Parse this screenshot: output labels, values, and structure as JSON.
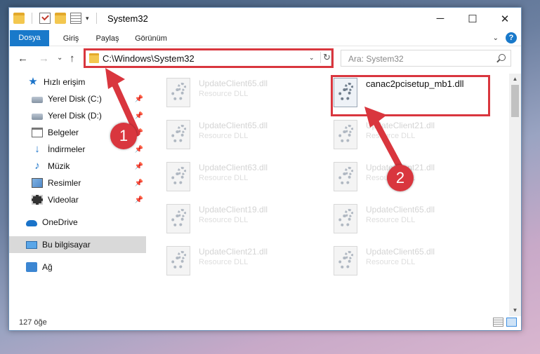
{
  "window": {
    "title": "System32",
    "minimize": "─",
    "maximize": "☐",
    "close": "✕"
  },
  "quick_access_toolbar": {
    "dropdown": "▾"
  },
  "ribbon": {
    "tabs": [
      "Dosya",
      "Giriş",
      "Paylaş",
      "Görünüm"
    ],
    "collapse": "⌄",
    "help": "?"
  },
  "nav": {
    "back": "←",
    "forward": "→",
    "recent": "⌄",
    "up": "↑"
  },
  "address": {
    "path": "C:\\Windows\\System32",
    "dropdown": "⌄",
    "refresh": "↻"
  },
  "search": {
    "placeholder": "Ara: System32"
  },
  "sidebar": {
    "items": [
      {
        "label": "Hızlı erişim",
        "icon": "star-icon",
        "pinned": false
      },
      {
        "label": "Yerel Disk (C:)",
        "icon": "drive-icon",
        "pinned": true
      },
      {
        "label": "Yerel Disk (D:)",
        "icon": "drive-icon",
        "pinned": true
      },
      {
        "label": "Belgeler",
        "icon": "documents-icon",
        "pinned": true
      },
      {
        "label": "İndirmeler",
        "icon": "download-icon",
        "pinned": true
      },
      {
        "label": "Müzik",
        "icon": "music-icon",
        "pinned": true
      },
      {
        "label": "Resimler",
        "icon": "pictures-icon",
        "pinned": true
      },
      {
        "label": "Videolar",
        "icon": "video-icon",
        "pinned": true
      },
      {
        "label": "OneDrive",
        "icon": "cloud-icon",
        "pinned": false
      },
      {
        "label": "Bu bilgisayar",
        "icon": "computer-icon",
        "pinned": false,
        "selected": true
      },
      {
        "label": "Ağ",
        "icon": "network-icon",
        "pinned": false
      }
    ],
    "pin_glyph": "📌"
  },
  "files": [
    {
      "name": "UpdateClient65.dll",
      "type": "Resource DLL",
      "active": false
    },
    {
      "name": "canac2pcisetup_mb1.dll",
      "type": "",
      "active": true
    },
    {
      "name": "UpdateClient65.dll",
      "type": "Resource DLL",
      "active": false
    },
    {
      "name": "UpdateClient21.dll",
      "type": "Resource DLL",
      "active": false
    },
    {
      "name": "UpdateClient63.dll",
      "type": "Resource DLL",
      "active": false
    },
    {
      "name": "UpdateClient21.dll",
      "type": "Resource DLL",
      "active": false
    },
    {
      "name": "UpdateClient19.dll",
      "type": "Resource DLL",
      "active": false
    },
    {
      "name": "UpdateClient65.dll",
      "type": "Resource DLL",
      "active": false
    },
    {
      "name": "UpdateClient21.dll",
      "type": "Resource DLL",
      "active": false
    },
    {
      "name": "UpdateClient65.dll",
      "type": "Resource DLL",
      "active": false
    }
  ],
  "scrollbar": {
    "up": "▲",
    "down": "▼"
  },
  "status": {
    "item_count": "127 öğe"
  },
  "annotations": {
    "step1": "1",
    "step2": "2",
    "highlight_color": "#d9363e"
  },
  "colors": {
    "accent": "#1979ca",
    "selected_bg": "#d9d9d9"
  }
}
